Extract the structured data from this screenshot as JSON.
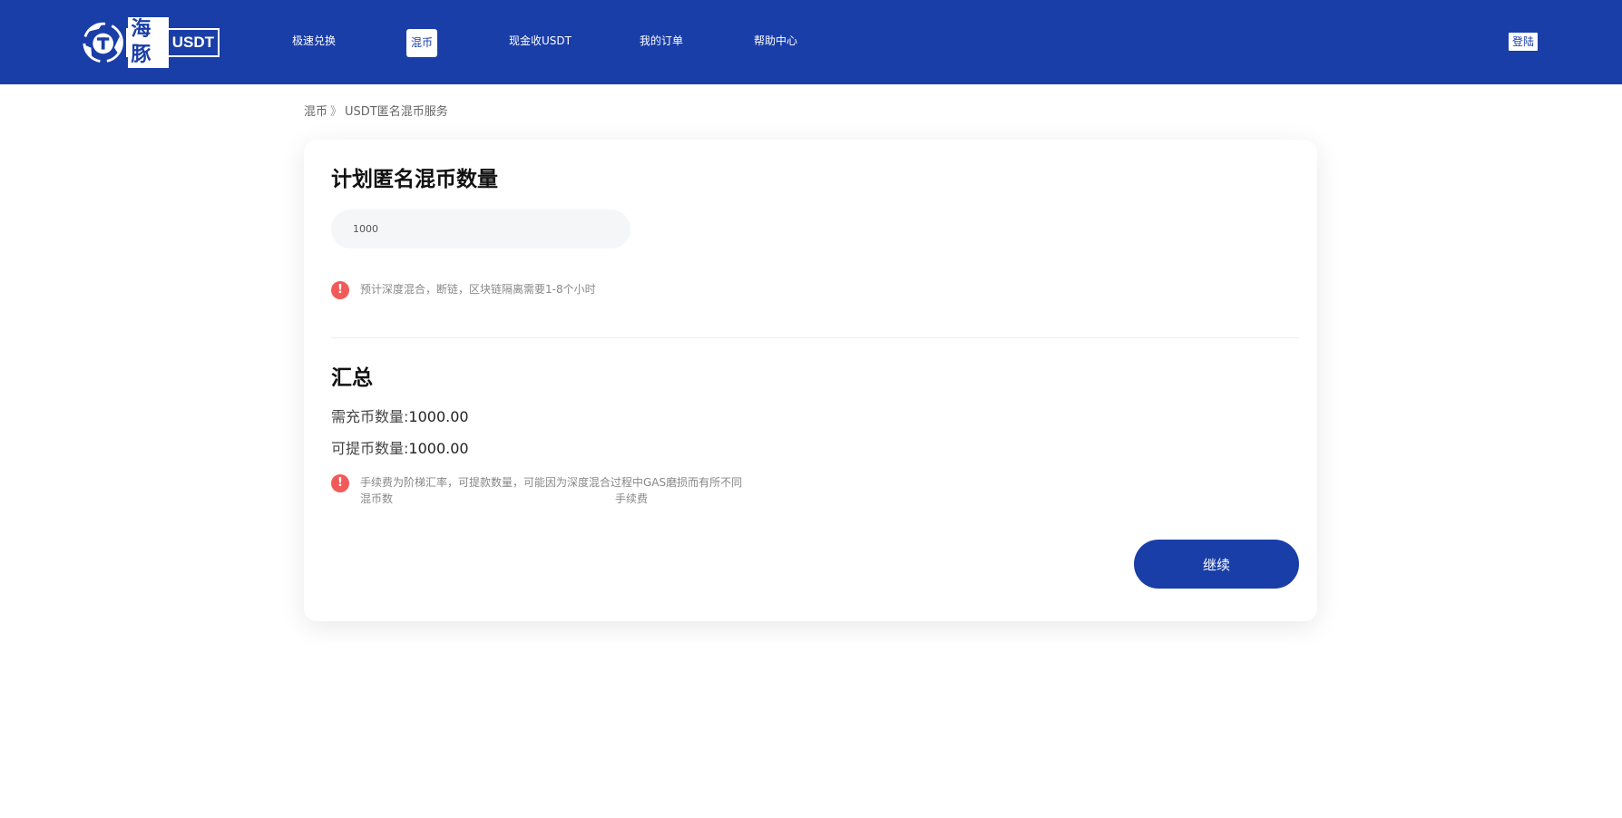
{
  "header": {
    "logo": {
      "cn": "海豚",
      "en": "USDT"
    },
    "nav": [
      {
        "label": "极速兑换"
      },
      {
        "label": "混币"
      },
      {
        "label": "现金收USDT"
      },
      {
        "label": "我的订单"
      },
      {
        "label": "帮助中心"
      }
    ],
    "login_label": "登陆"
  },
  "breadcrumb": {
    "parent": "混币",
    "separator": "》",
    "current": "USDT匿名混币服务"
  },
  "form": {
    "title": "计划匿名混币数量",
    "amount_value": "1000",
    "notice": "预计深度混合，断链，区块链隔离需要1-8个小时"
  },
  "summary": {
    "title": "汇总",
    "deposit_label": "需充币数量:",
    "deposit_value": "1000.00",
    "withdraw_label": "可提币数量:",
    "withdraw_value": "1000.00",
    "fee_notice_line1": "手续费为阶梯汇率，可提款数量，可能因为深度混合过程中GAS磨损而有所不同",
    "fee_notice_left": "混币数",
    "fee_notice_right": "手续费"
  },
  "continue_label": "继续",
  "colors": {
    "brand": "#1a3ea8",
    "alert": "#f25a5a"
  },
  "icons": {
    "logo": "dolphin-t-logo-icon",
    "alert": "exclamation-circle-icon"
  }
}
